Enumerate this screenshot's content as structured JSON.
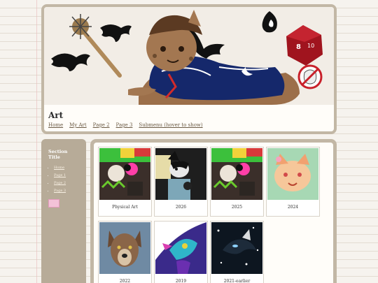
{
  "site": {
    "title": "Art"
  },
  "nav": {
    "items": [
      "Home",
      "My Art",
      "Page 2",
      "Page 3",
      "Submenu (hover to show)"
    ]
  },
  "sidebar": {
    "title": "Section Title",
    "links": [
      "Home",
      "Page 1",
      "Page 2",
      "Page 3"
    ]
  },
  "gallery": {
    "items": [
      {
        "caption": "Physical Art"
      },
      {
        "caption": "2026"
      },
      {
        "caption": "2025"
      },
      {
        "caption": "2024"
      },
      {
        "caption": "2022"
      },
      {
        "caption": "2019"
      },
      {
        "caption": "2021-earlier"
      }
    ]
  },
  "colors": {
    "frame": "#c2b7a5",
    "sidebar": "#b7ab98",
    "link": "#6b5a44"
  }
}
